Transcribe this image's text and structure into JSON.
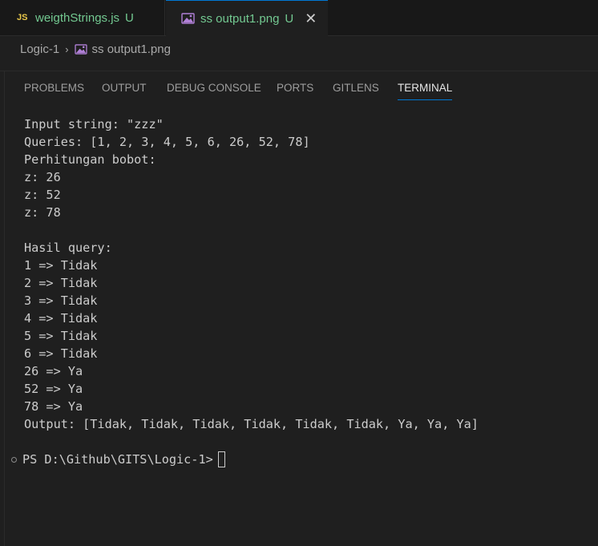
{
  "tabs": [
    {
      "icon": "JS",
      "title": "weigthStrings.js",
      "status": "U"
    },
    {
      "title": "ss output1.png",
      "status": "U",
      "close": "✕"
    }
  ],
  "breadcrumb": {
    "folder": "Logic-1",
    "separator": "›",
    "file": "ss output1.png"
  },
  "panel_tabs": [
    "PROBLEMS",
    "OUTPUT",
    "DEBUG CONSOLE",
    "PORTS",
    "GITLENS",
    "TERMINAL"
  ],
  "terminal": {
    "lines": [
      "Input string: \"zzz\"",
      "Queries: [1, 2, 3, 4, 5, 6, 26, 52, 78]",
      "Perhitungan bobot:",
      "z: 26",
      "z: 52",
      "z: 78",
      "",
      "Hasil query:",
      "1 => Tidak",
      "2 => Tidak",
      "3 => Tidak",
      "4 => Tidak",
      "5 => Tidak",
      "6 => Tidak",
      "26 => Ya",
      "52 => Ya",
      "78 => Ya",
      "Output: [Tidak, Tidak, Tidak, Tidak, Tidak, Tidak, Ya, Ya, Ya]"
    ],
    "prompt": "PS D:\\Github\\GITS\\Logic-1>"
  },
  "colors": {
    "accent": "#0078d4",
    "untracked": "#73c991",
    "js_icon": "#e8c74a",
    "background": "#1f1f1f"
  }
}
